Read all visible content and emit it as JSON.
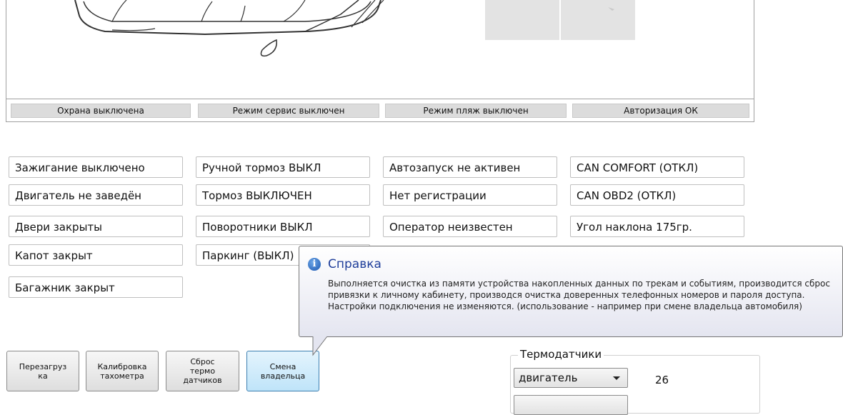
{
  "status_bar": [
    "Охрана выключена",
    "Режим сервис выключен",
    "Режим пляж выключен",
    "Авторизация ОК"
  ],
  "indicators": {
    "col1": [
      "Зажигание выключено",
      "Двигатель не заведён",
      "Двери закрыты",
      "Капот закрыт",
      "Багажник закрыт"
    ],
    "col2": [
      "Ручной тормоз ВЫКЛ",
      "Тормоз ВЫКЛЮЧЕН",
      "Поворотники ВЫКЛ",
      "Паркинг (ВЫКЛ)"
    ],
    "col3": [
      "Автозапуск не активен",
      "Нет регистрации",
      "Оператор неизвестен"
    ],
    "col4": [
      "CAN COMFORT (ОТКЛ)",
      "CAN OBD2 (ОТКЛ)",
      "Угол наклона 175гр."
    ]
  },
  "buttons": {
    "reboot": "Перезагруз\nка",
    "calibrate": "Калибровка\nтахометра",
    "reset_sensors": "Сброс\nтермо\nдатчиков",
    "change_owner": "Смена\nвладельца"
  },
  "tooltip": {
    "title": "Справка",
    "text": "Выполняется очистка из памяти устройства накопленных данных по трекам и событиям, производится сброс привязки к личному кабинету, производся очистка доверенных телефонных номеров и пароля доступа. Настройки подключения не изменяются.  (использование - например при смене владельца автомобиля)"
  },
  "thermo": {
    "title": "Термодатчики",
    "sensor_selected": "двигатель",
    "value": "26"
  }
}
